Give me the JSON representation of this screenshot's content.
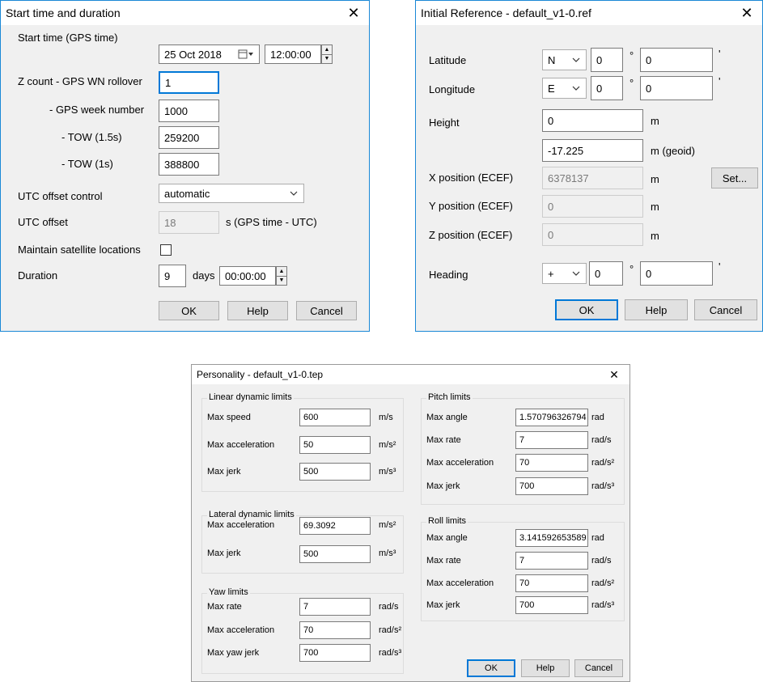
{
  "start_dialog": {
    "title": "Start time and duration",
    "close_glyph": "✕",
    "start_time_label": "Start time (GPS time)",
    "date_value": "25 Oct  2018",
    "time_value": "12:00:00",
    "z_count_label": "Z count - GPS WN rollover",
    "z_count_value": "1",
    "week_number_label": "- GPS week number",
    "week_number_value": "1000",
    "tow15_label": "- TOW (1.5s)",
    "tow15_value": "259200",
    "tow1_label": "- TOW (1s)",
    "tow1_value": "388800",
    "utc_control_label": "UTC offset control",
    "utc_control_value": "automatic",
    "utc_offset_label": "UTC offset",
    "utc_offset_value": "18",
    "utc_offset_unit": "s   (GPS time - UTC)",
    "maintain_label": "Maintain satellite locations",
    "maintain_checked": false,
    "duration_label": "Duration",
    "duration_days": "9",
    "days_label": "days",
    "duration_time": "00:00:00",
    "ok_label": "OK",
    "help_label": "Help",
    "cancel_label": "Cancel"
  },
  "ref_dialog": {
    "title": "Initial Reference - default_v1-0.ref",
    "close_glyph": "✕",
    "latitude_label": "Latitude",
    "lat_hemisphere": "N",
    "lat_degrees": "0",
    "lat_minutes": "0",
    "longitude_label": "Longitude",
    "lon_hemisphere": "E",
    "lon_degrees": "0",
    "lon_minutes": "0",
    "degree_symbol": "°",
    "minute_symbol": "'",
    "height_label": "Height",
    "height_value": "0",
    "height_unit": "m",
    "geoid_value": "-17.225",
    "geoid_unit": "m (geoid)",
    "x_label": "X position (ECEF)",
    "x_value": "6378137",
    "y_label": "Y position (ECEF)",
    "y_value": "0",
    "z_label": "Z position (ECEF)",
    "z_value": "0",
    "m_unit": "m",
    "set_label": "Set...",
    "heading_label": "Heading",
    "heading_sign": "+",
    "heading_degrees": "0",
    "heading_minutes": "0",
    "ok_label": "OK",
    "help_label": "Help",
    "cancel_label": "Cancel"
  },
  "personality_dialog": {
    "title": "Personality - default_v1-0.tep",
    "close_glyph": "✕",
    "linear": {
      "title": "Linear dynamic limits",
      "rows": [
        {
          "label": "Max speed",
          "value": "600",
          "unit": "m/s"
        },
        {
          "label": "Max acceleration",
          "value": "50",
          "unit": "m/s²"
        },
        {
          "label": "Max jerk",
          "value": "500",
          "unit": "m/s³"
        }
      ]
    },
    "lateral": {
      "title": "Lateral dynamic limits",
      "rows": [
        {
          "label": "Max acceleration",
          "value": "69.3092",
          "unit": "m/s²"
        },
        {
          "label": "Max jerk",
          "value": "500",
          "unit": "m/s³"
        }
      ]
    },
    "yaw": {
      "title": "Yaw limits",
      "rows": [
        {
          "label": "Max rate",
          "value": "7",
          "unit": "rad/s"
        },
        {
          "label": "Max acceleration",
          "value": "70",
          "unit": "rad/s²"
        },
        {
          "label": "Max yaw jerk",
          "value": "700",
          "unit": "rad/s³"
        }
      ]
    },
    "pitch": {
      "title": "Pitch limits",
      "rows": [
        {
          "label": "Max angle",
          "value": "1.570796326794",
          "unit": "rad"
        },
        {
          "label": "Max rate",
          "value": "7",
          "unit": "rad/s"
        },
        {
          "label": "Max acceleration",
          "value": "70",
          "unit": "rad/s²"
        },
        {
          "label": "Max jerk",
          "value": "700",
          "unit": "rad/s³"
        }
      ]
    },
    "roll": {
      "title": "Roll limits",
      "rows": [
        {
          "label": "Max angle",
          "value": "3.141592653589",
          "unit": "rad"
        },
        {
          "label": "Max rate",
          "value": "7",
          "unit": "rad/s"
        },
        {
          "label": "Max acceleration",
          "value": "70",
          "unit": "rad/s²"
        },
        {
          "label": "Max jerk",
          "value": "700",
          "unit": "rad/s³"
        }
      ]
    },
    "ok_label": "OK",
    "help_label": "Help",
    "cancel_label": "Cancel"
  },
  "colors": {
    "accent": "#0078d7",
    "window_border": "#1a88d6",
    "dialog_bg": "#f0f0f0",
    "button_bg": "#e1e1e1"
  }
}
